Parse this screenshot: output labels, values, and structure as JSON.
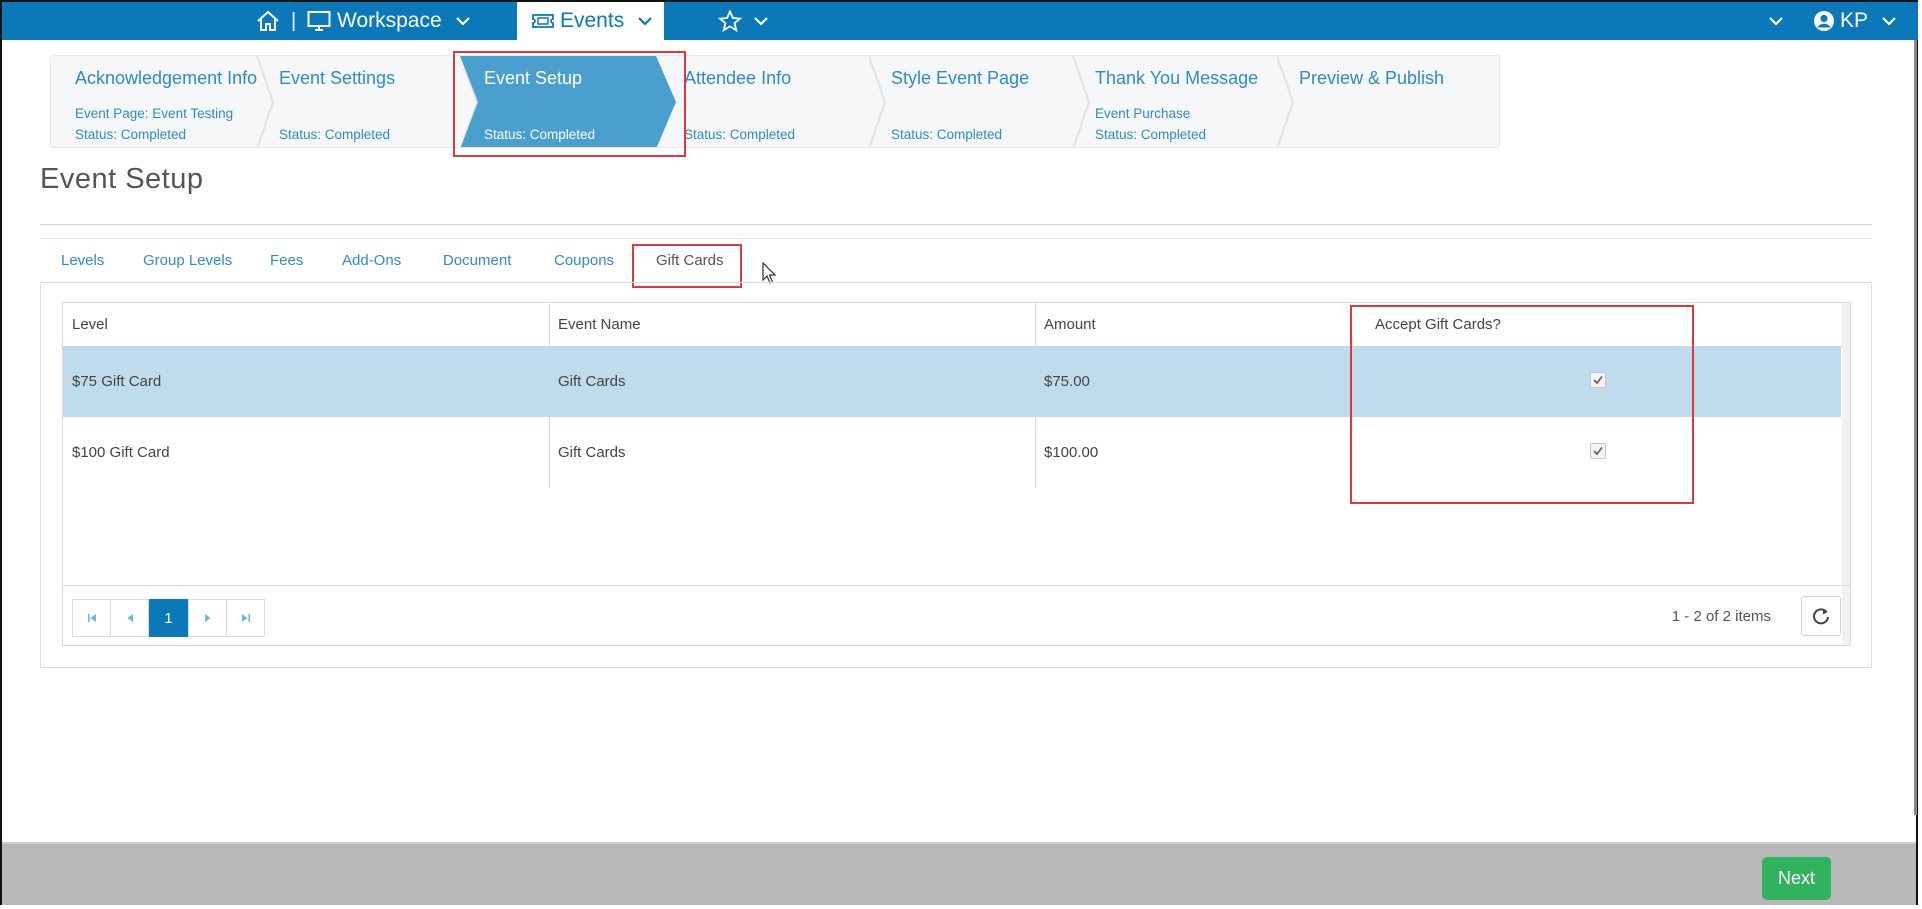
{
  "nav": {
    "workspace_label": "Workspace",
    "events_label": "Events",
    "separator": "|",
    "user_initials": "KP"
  },
  "wizard": {
    "steps": [
      {
        "title": "Acknowledgement Info",
        "subs": [
          "Event Page: Event Testing",
          "Status: Completed"
        ]
      },
      {
        "title": "Event Settings",
        "subs": [
          "Status: Completed"
        ]
      },
      {
        "title": "Event Setup",
        "subs": [
          "Status: Completed"
        ]
      },
      {
        "title": "Attendee Info",
        "subs": [
          "Status: Completed"
        ]
      },
      {
        "title": "Style Event Page",
        "subs": [
          "Status: Completed"
        ]
      },
      {
        "title": "Thank You Message",
        "subs": [
          "Event Purchase",
          "Status: Completed"
        ]
      },
      {
        "title": "Preview & Publish",
        "subs": []
      }
    ]
  },
  "page": {
    "title": "Event Setup"
  },
  "tabs": [
    "Levels",
    "Group Levels",
    "Fees",
    "Add-Ons",
    "Document",
    "Coupons",
    "Gift Cards"
  ],
  "grid": {
    "headers": [
      "Level",
      "Event Name",
      "Amount",
      "Accept Gift Cards?"
    ],
    "rows": [
      {
        "level": "$75 Gift Card",
        "event": "Gift Cards",
        "amount": "$75.00",
        "accept": true
      },
      {
        "level": "$100 Gift Card",
        "event": "Gift Cards",
        "amount": "$100.00",
        "accept": true
      }
    ]
  },
  "pager": {
    "current_page": "1",
    "info": "1 - 2 of 2 items"
  },
  "footer": {
    "next_label": "Next"
  },
  "colors": {
    "nav_blue": "#0a78b9",
    "active_step": "#4b9fcf",
    "link_blue": "#2f8bc7",
    "highlight_red": "#e2373a",
    "next_green": "#30b25f"
  }
}
